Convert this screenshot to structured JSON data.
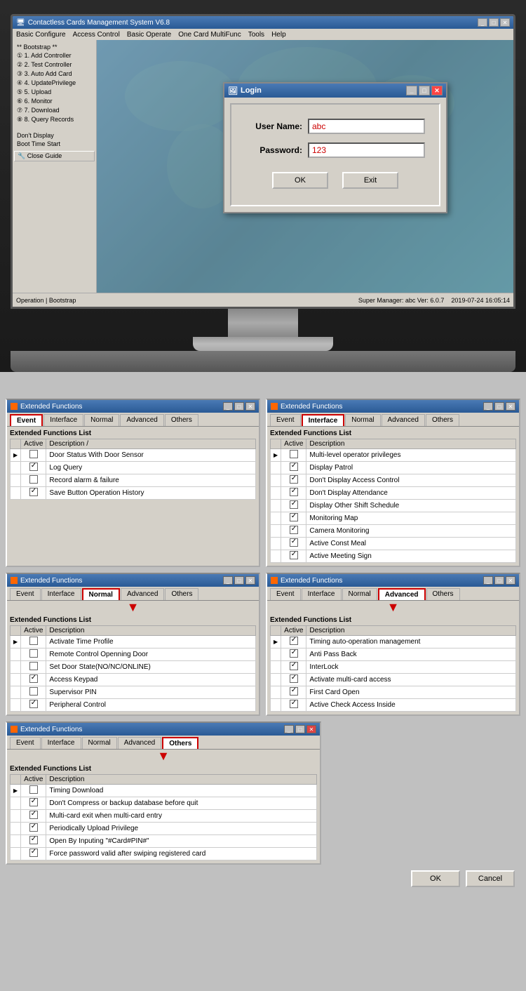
{
  "monitor": {
    "title": "Contactless Cards Management System  V6.8",
    "menu_items": [
      "Basic Configure",
      "Access Control",
      "Basic Operate",
      "One Card MultiFunc",
      "Tools",
      "Help"
    ],
    "sidebar_items": [
      "Bootstrap ##",
      "① 1. Add Controller",
      "② 2. Test Controller",
      "③ 3. Auto Add Card",
      "④ 4. UpdatePrivilege",
      "⑤ 5. Upload",
      "⑥ 6. Monitor",
      "⑦ 7. Download",
      "⑧ 8. Query Records",
      "Don't Display",
      "Boot Time Start",
      "Close Guide"
    ],
    "login": {
      "title": "Login",
      "username_label": "User Name:",
      "password_label": "Password:",
      "username_value": "abc",
      "password_value": "123",
      "ok_button": "OK",
      "exit_button": "Exit"
    },
    "statusbar_left": "Operation | Bootstrap",
    "statusbar_right": "Super Manager: abc   Ver: 6.0.7",
    "timestamp": "2019-07-24 16:05:14"
  },
  "window1": {
    "title": "Extended Functions",
    "tabs": [
      "Event",
      "Interface",
      "Normal",
      "Advanced",
      "Others"
    ],
    "active_tab": "Event",
    "list_title": "Extended Functions List",
    "columns": [
      "Active",
      "Description"
    ],
    "rows": [
      {
        "checked": false,
        "label": "Door Status With Door Sensor",
        "arrow": true
      },
      {
        "checked": true,
        "label": "Log Query"
      },
      {
        "checked": false,
        "label": "Record alarm & failure"
      },
      {
        "checked": true,
        "label": "Save Button Operation History"
      }
    ]
  },
  "window2": {
    "title": "Extended Functions",
    "tabs": [
      "Event",
      "Interface",
      "Normal",
      "Advanced",
      "Others"
    ],
    "active_tab": "Interface",
    "list_title": "Extended Functions List",
    "columns": [
      "Active",
      "Description"
    ],
    "rows": [
      {
        "checked": false,
        "label": "Multi-level operator privileges",
        "arrow": true
      },
      {
        "checked": true,
        "label": "Display Patrol"
      },
      {
        "checked": true,
        "label": "Don't Display Access Control"
      },
      {
        "checked": true,
        "label": "Don't Display Attendance"
      },
      {
        "checked": true,
        "label": "Display Other Shift Schedule"
      },
      {
        "checked": true,
        "label": "Monitoring Map"
      },
      {
        "checked": true,
        "label": "Camera Monitoring"
      },
      {
        "checked": true,
        "label": "Active Const Meal"
      },
      {
        "checked": true,
        "label": "Active Meeting Sign"
      }
    ]
  },
  "window3": {
    "title": "Extended Functions",
    "tabs": [
      "Event",
      "Interface",
      "Normal",
      "Advanced",
      "Others"
    ],
    "active_tab": "Normal",
    "list_title": "Extended Functions List",
    "columns": [
      "Active",
      "Description"
    ],
    "rows": [
      {
        "checked": false,
        "label": "Activate Time Profile",
        "arrow": true
      },
      {
        "checked": false,
        "label": "Remote Control Openning Door"
      },
      {
        "checked": false,
        "label": "Set Door State(NO/NC/ONLINE)"
      },
      {
        "checked": true,
        "label": "Access Keypad"
      },
      {
        "checked": false,
        "label": "Supervisor PIN"
      },
      {
        "checked": true,
        "label": "Peripheral Control"
      }
    ]
  },
  "window4": {
    "title": "Extended Functions",
    "tabs": [
      "Event",
      "Interface",
      "Normal",
      "Advanced",
      "Others"
    ],
    "active_tab": "Advanced",
    "list_title": "Extended Functions List",
    "columns": [
      "Active",
      "Description"
    ],
    "rows": [
      {
        "checked": true,
        "label": "Timing auto-operation management",
        "arrow": true
      },
      {
        "checked": true,
        "label": "Anti Pass Back"
      },
      {
        "checked": true,
        "label": "InterLock"
      },
      {
        "checked": true,
        "label": "Activate multi-card access"
      },
      {
        "checked": true,
        "label": "First Card Open"
      },
      {
        "checked": true,
        "label": "Active Check Access Inside"
      }
    ]
  },
  "window5": {
    "title": "Extended Functions",
    "tabs": [
      "Event",
      "Interface",
      "Normal",
      "Advanced",
      "Others"
    ],
    "active_tab": "Others",
    "list_title": "Extended Functions List",
    "columns": [
      "Active",
      "Description"
    ],
    "rows": [
      {
        "checked": false,
        "label": "Timing Download",
        "arrow": true
      },
      {
        "checked": true,
        "label": "Don't Compress or backup database before quit"
      },
      {
        "checked": true,
        "label": "Multi-card exit when multi-card entry"
      },
      {
        "checked": true,
        "label": "Periodically Upload Privilege"
      },
      {
        "checked": true,
        "label": "Open By Inputing \"#Card#PIN#\""
      },
      {
        "checked": true,
        "label": "Force password valid after swiping registered card"
      }
    ]
  },
  "bottom_buttons": {
    "ok": "OK",
    "cancel": "Cancel"
  }
}
